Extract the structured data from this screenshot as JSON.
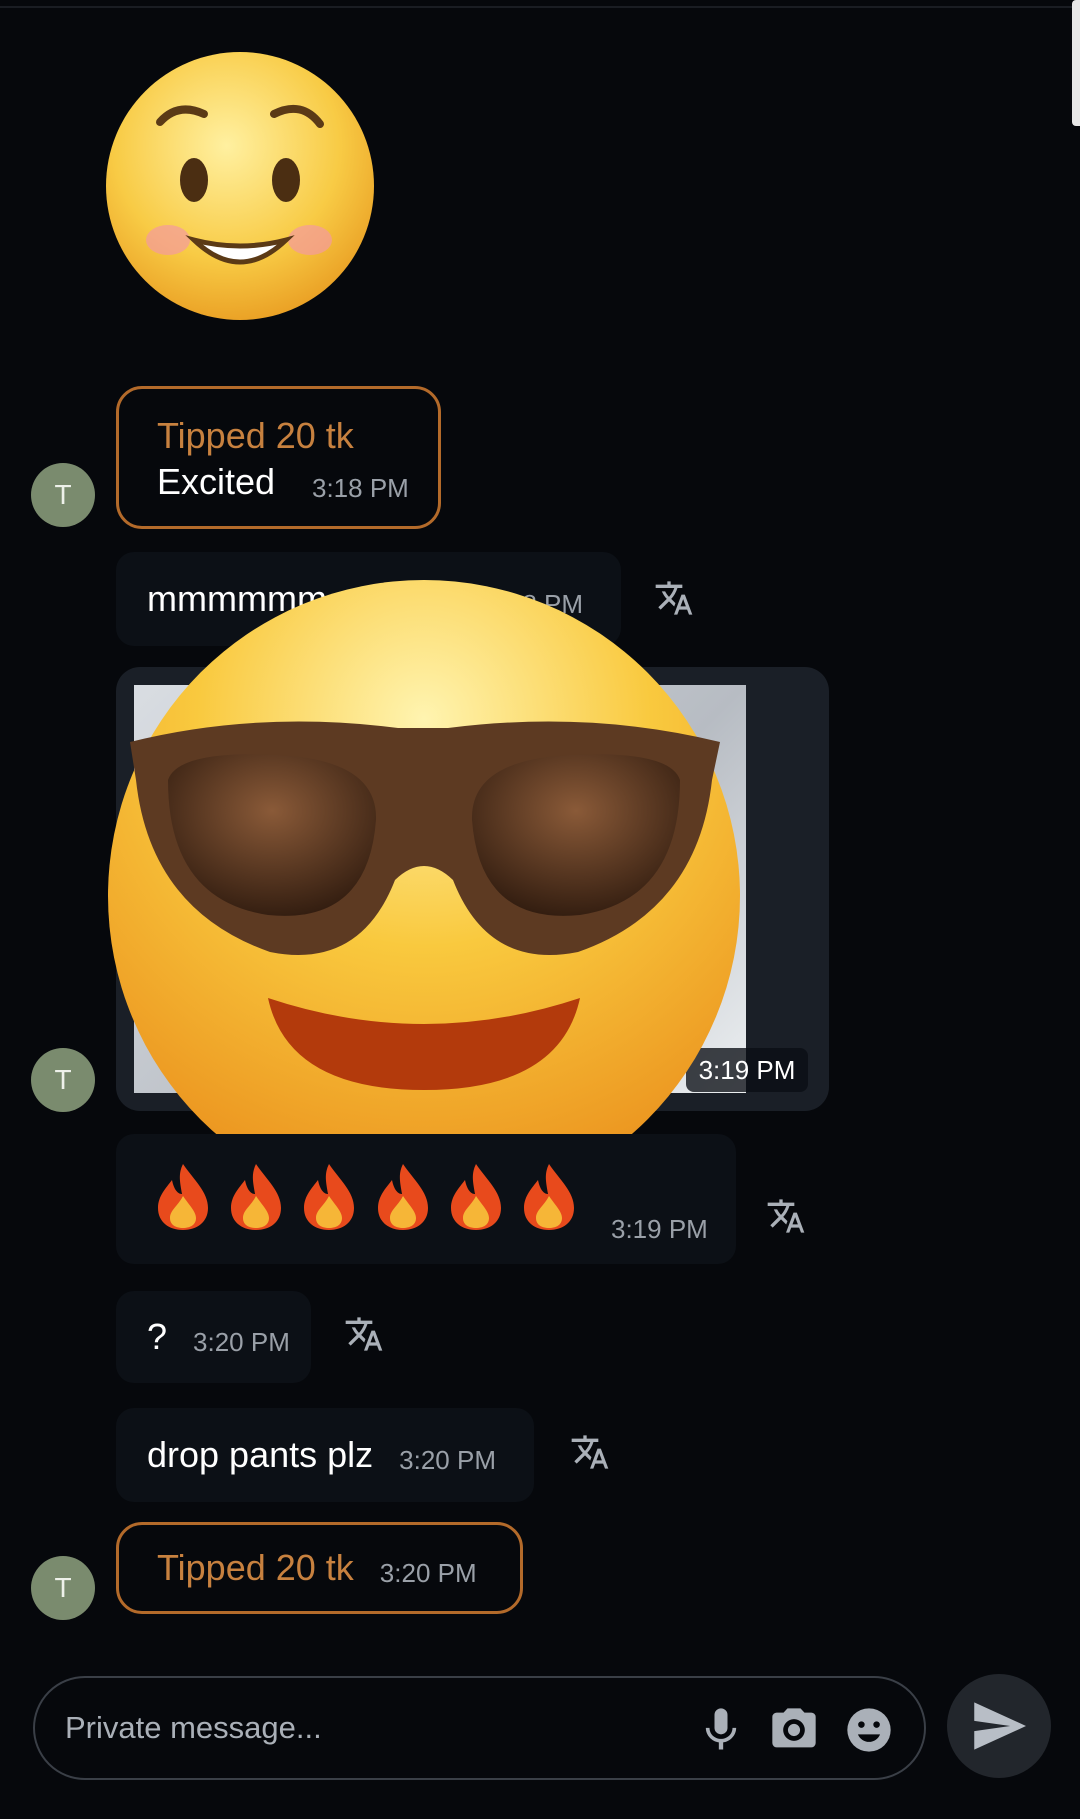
{
  "messages": {
    "tip1": {
      "amount": "Tipped 20 tk",
      "caption": "Excited",
      "time": "3:18 PM"
    },
    "msg1": {
      "text": "mmmmmm",
      "time": "3:18 PM"
    },
    "photo": {
      "time": "3:19 PM"
    },
    "fire": {
      "emoji": "🔥",
      "count": 6,
      "time": "3:19 PM"
    },
    "msg2": {
      "text": "?",
      "time": "3:20 PM"
    },
    "msg3": {
      "text": "drop pants plz",
      "time": "3:20 PM"
    },
    "tip2": {
      "amount": "Tipped 20 tk",
      "time": "3:20 PM"
    }
  },
  "avatar_initial": "T",
  "composer": {
    "placeholder": "Private message..."
  },
  "icons": {
    "translate": "translate-icon",
    "mic": "microphone-icon",
    "camera": "camera-icon",
    "emoji": "emoji-icon",
    "send": "send-icon"
  },
  "colors": {
    "background": "#06080c",
    "tip_border": "#b36a2a",
    "tip_text": "#c7813f",
    "avatar": "#7a8b6e"
  }
}
